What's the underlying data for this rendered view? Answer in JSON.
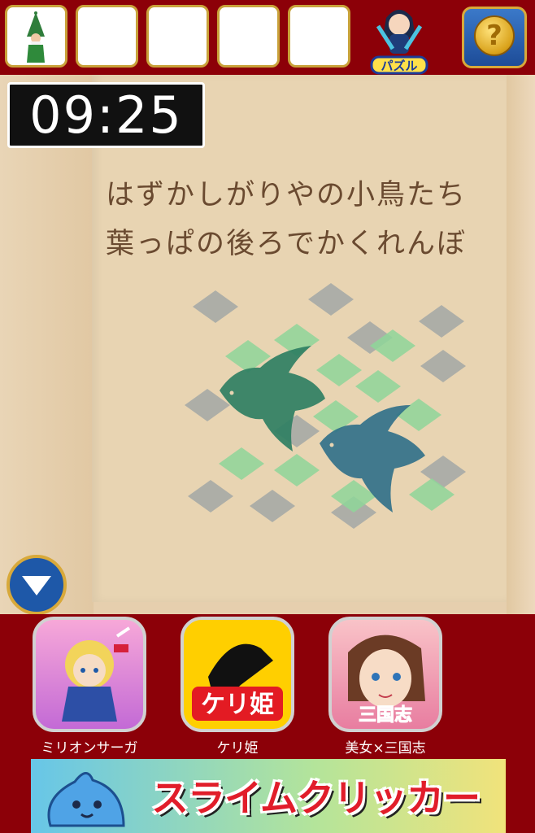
{
  "hud": {
    "timer": "09:25",
    "logo_text": "パズル",
    "help_label": "?"
  },
  "inventory": {
    "slots": [
      {
        "item": "gnome-figure"
      },
      {
        "item": ""
      },
      {
        "item": ""
      },
      {
        "item": ""
      },
      {
        "item": ""
      }
    ]
  },
  "poem": {
    "line1": "はずかしがりやの小鳥たち",
    "line2": "葉っぱの後ろでかくれんぼ"
  },
  "ads": {
    "apps": [
      {
        "label": "ミリオンサーガ",
        "icon": "knight-girl-icon"
      },
      {
        "label": "ケリ姫",
        "icon": "kerihime-icon",
        "icon_text": "ケリ姫"
      },
      {
        "label": "美女×三国志",
        "icon": "sangokushi-girl-icon",
        "icon_text": "三国志"
      }
    ],
    "banner_text": "スライムクリッカー"
  },
  "colors": {
    "frame": "#8c0008",
    "gold_border": "#c9a23a",
    "paper": "#e8d4b2",
    "ink": "#6a4a30",
    "bird_green": "#2f7f63",
    "bird_blue": "#2f6f88"
  }
}
